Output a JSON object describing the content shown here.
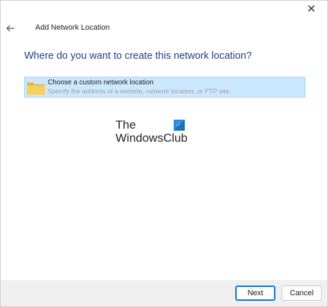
{
  "window": {
    "close_glyph": "✕",
    "title": "Add Network Location"
  },
  "main": {
    "heading": "Where do you want to create this network location?",
    "options": [
      {
        "icon": "folder-icon",
        "title": "Choose a custom network location",
        "description": "Specify the address of a website, network location, or FTP site.",
        "selected": true
      }
    ]
  },
  "watermark": {
    "line1": "The",
    "line2": "WindowsClub"
  },
  "footer": {
    "next_label": "Next",
    "cancel_label": "Cancel"
  },
  "colors": {
    "heading": "#1e3f8a",
    "selection_bg": "#cce8ff",
    "selection_border": "#99d1ff",
    "footer_bg": "#f0f0f0",
    "accent": "#0a6fd1"
  }
}
